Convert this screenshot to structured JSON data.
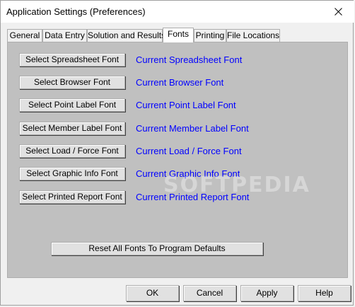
{
  "window": {
    "title": "Application Settings (Preferences)"
  },
  "tabs": [
    {
      "label": "General",
      "active": false
    },
    {
      "label": "Data Entry",
      "active": false
    },
    {
      "label": "Solution and Results",
      "active": false
    },
    {
      "label": "Fonts",
      "active": true
    },
    {
      "label": "Printing",
      "active": false
    },
    {
      "label": "File Locations",
      "active": false
    }
  ],
  "fonts": [
    {
      "button": "Select Spreadsheet Font",
      "current": "Current Spreadsheet Font"
    },
    {
      "button": "Select Browser Font",
      "current": "Current Browser Font"
    },
    {
      "button": "Select Point Label Font",
      "current": "Current Point Label Font"
    },
    {
      "button": "Select Member Label Font",
      "current": "Current Member Label Font"
    },
    {
      "button": "Select Load / Force Font",
      "current": "Current Load / Force Font"
    },
    {
      "button": "Select Graphic Info Font",
      "current": "Current Graphic Info Font"
    },
    {
      "button": "Select Printed Report Font",
      "current": "Current Printed Report Font"
    }
  ],
  "reset_label": "Reset All Fonts To Program Defaults",
  "footer": {
    "ok": "OK",
    "cancel": "Cancel",
    "apply": "Apply",
    "help": "Help"
  },
  "watermark": "SOFTPEDIA",
  "colors": {
    "panel_bg": "#c0c0c0",
    "font_label": "#0000ff"
  }
}
